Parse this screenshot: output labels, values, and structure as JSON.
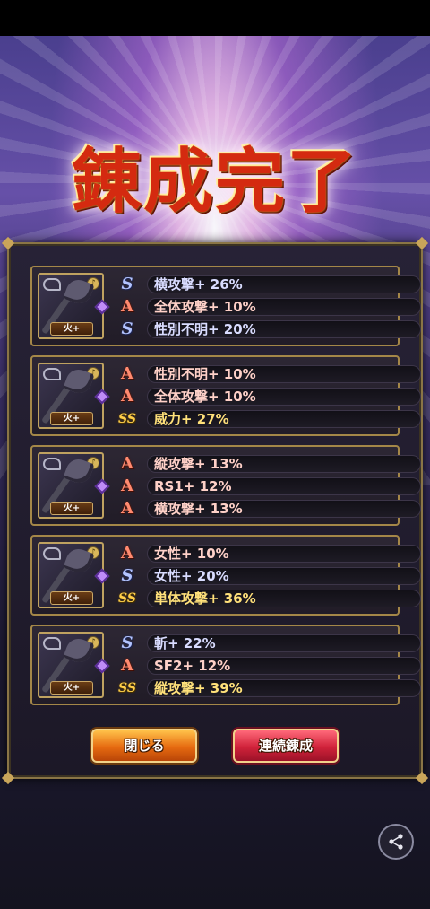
{
  "title": "錬成完了",
  "cards": [
    {
      "element": "火+",
      "stats": [
        {
          "rank": "S",
          "rank_label": "S",
          "text": "横攻撃+ 26%"
        },
        {
          "rank": "A",
          "rank_label": "A",
          "text": "全体攻撃+ 10%"
        },
        {
          "rank": "S",
          "rank_label": "S",
          "text": "性別不明+ 20%"
        }
      ]
    },
    {
      "element": "火+",
      "stats": [
        {
          "rank": "A",
          "rank_label": "A",
          "text": "性別不明+ 10%"
        },
        {
          "rank": "A",
          "rank_label": "A",
          "text": "全体攻撃+ 10%"
        },
        {
          "rank": "SS",
          "rank_label": "SS",
          "text": "威力+ 27%"
        }
      ]
    },
    {
      "element": "火+",
      "stats": [
        {
          "rank": "A",
          "rank_label": "A",
          "text": "縦攻撃+ 13%"
        },
        {
          "rank": "A",
          "rank_label": "A",
          "text": "RS1+ 12%"
        },
        {
          "rank": "A",
          "rank_label": "A",
          "text": "横攻撃+ 13%"
        }
      ]
    },
    {
      "element": "火+",
      "stats": [
        {
          "rank": "A",
          "rank_label": "A",
          "text": "女性+ 10%"
        },
        {
          "rank": "S",
          "rank_label": "S",
          "text": "女性+ 20%"
        },
        {
          "rank": "SS",
          "rank_label": "SS",
          "text": "単体攻撃+ 36%"
        }
      ]
    },
    {
      "element": "火+",
      "stats": [
        {
          "rank": "S",
          "rank_label": "S",
          "text": "斬+ 22%"
        },
        {
          "rank": "A",
          "rank_label": "A",
          "text": "SF2+ 12%"
        },
        {
          "rank": "SS",
          "rank_label": "SS",
          "text": "縦攻撃+ 39%"
        }
      ]
    }
  ],
  "buttons": {
    "close_label": "閉じる",
    "continue_label": "連続錬成"
  },
  "icons": {
    "weapon": "battle-axe-icon",
    "element_gem": "gem-icon",
    "share": "share-icon"
  },
  "colors": {
    "rank_S": "#b3c4ff",
    "rank_A": "#ff8a70",
    "rank_SS": "#ffcf4a",
    "close_button": "#e66a10",
    "continue_button": "#d0223a"
  }
}
